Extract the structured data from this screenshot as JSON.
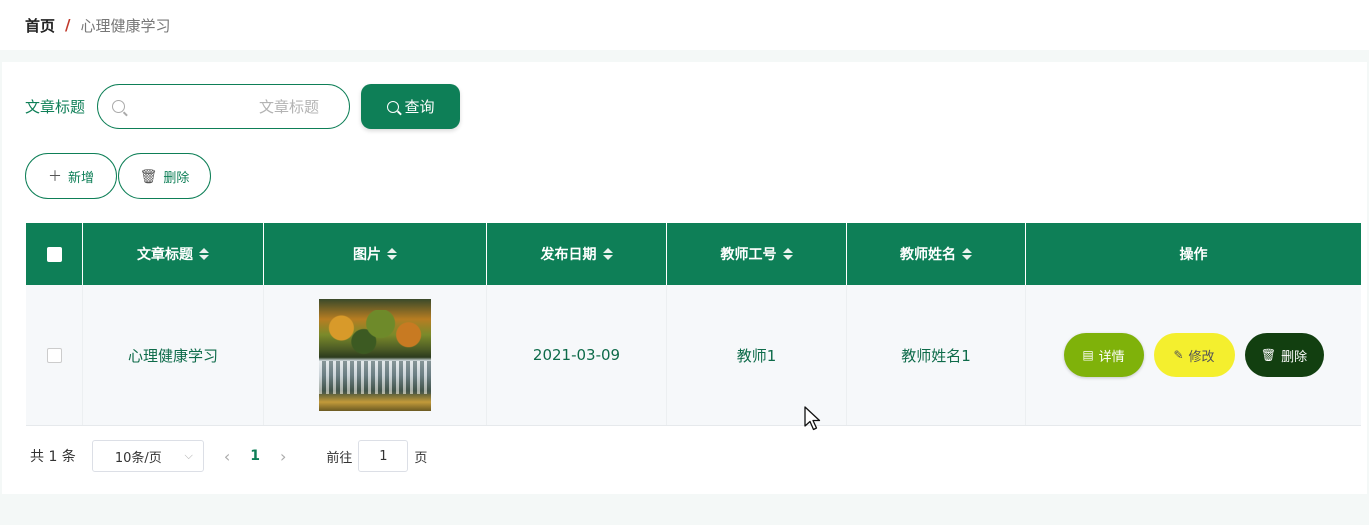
{
  "breadcrumb": {
    "home": "首页",
    "separator": "/",
    "current": "心理健康学习"
  },
  "search": {
    "label": "文章标题",
    "placeholder": "文章标题",
    "value": "",
    "query_label": "查询"
  },
  "actions": {
    "add_label": "新增",
    "delete_label": "删除"
  },
  "table": {
    "columns": [
      "文章标题",
      "图片",
      "发布日期",
      "教师工号",
      "教师姓名",
      "操作"
    ],
    "rows": [
      {
        "title": "心理健康学习",
        "image": "waterfall-photo",
        "date": "2021-03-09",
        "teacher_id": "教师1",
        "teacher_name": "教师姓名1",
        "ops": {
          "detail": "详情",
          "edit": "修改",
          "delete": "删除"
        }
      }
    ]
  },
  "pagination": {
    "total": "共 1 条",
    "page_size": "10条/页",
    "current_page": "1",
    "goto_label": "前往",
    "goto_value": "1",
    "goto_unit": "页"
  },
  "colors": {
    "primary": "#0e7f57",
    "detail": "#7fb20a",
    "edit": "#f4ef2e",
    "delete": "#123f10"
  }
}
